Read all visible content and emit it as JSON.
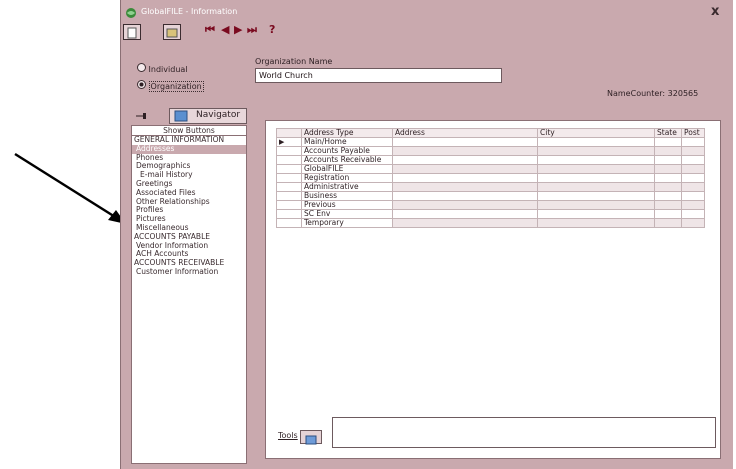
{
  "window": {
    "title": "GlobalFILE - Information",
    "close": "x"
  },
  "toolbar": {
    "help": "?",
    "nav_first": "⏮",
    "nav_prev": "◀",
    "nav_next": "▶",
    "nav_last": "⏭"
  },
  "type_selector": {
    "individual_label": "Individual",
    "organization_label": "Organization",
    "selected": "Organization"
  },
  "org": {
    "name_label": "Organization Name",
    "name_value": "World Church",
    "name_counter_label": "NameCounter:",
    "name_counter_value": "320565"
  },
  "navigator": {
    "pin_icon": "pin-icon",
    "button_label": "Navigator",
    "show_buttons": "Show Buttons",
    "items": [
      {
        "label": "GENERAL INFORMATION",
        "indent": 0,
        "selected": false
      },
      {
        "label": "Addresses",
        "indent": 1,
        "selected": true
      },
      {
        "label": "Phones",
        "indent": 1,
        "selected": false
      },
      {
        "label": "Demographics",
        "indent": 1,
        "selected": false
      },
      {
        "label": "E-mail History",
        "indent": 2,
        "selected": false
      },
      {
        "label": "Greetings",
        "indent": 1,
        "selected": false
      },
      {
        "label": "Associated Files",
        "indent": 1,
        "selected": false
      },
      {
        "label": "Other Relationships",
        "indent": 1,
        "selected": false
      },
      {
        "label": "Profiles",
        "indent": 1,
        "selected": false
      },
      {
        "label": "Pictures",
        "indent": 1,
        "selected": false
      },
      {
        "label": "Miscellaneous",
        "indent": 1,
        "selected": false
      },
      {
        "label": "ACCOUNTS PAYABLE",
        "indent": 0,
        "selected": false
      },
      {
        "label": "Vendor Information",
        "indent": 1,
        "selected": false
      },
      {
        "label": "ACH Accounts",
        "indent": 1,
        "selected": false
      },
      {
        "label": "ACCOUNTS RECEIVABLE",
        "indent": 0,
        "selected": false
      },
      {
        "label": "Customer Information",
        "indent": 1,
        "selected": false
      }
    ]
  },
  "grid": {
    "columns": [
      "Address Type",
      "Address",
      "City",
      "State",
      "Post"
    ],
    "rows": [
      {
        "type": "Main/Home",
        "current": true
      },
      {
        "type": "Accounts Payable",
        "current": false
      },
      {
        "type": "Accounts Receivable",
        "current": false
      },
      {
        "type": "GlobalFILE",
        "current": false
      },
      {
        "type": "Registration",
        "current": false
      },
      {
        "type": "Administrative",
        "current": false
      },
      {
        "type": "Business",
        "current": false
      },
      {
        "type": "Previous",
        "current": false
      },
      {
        "type": "SC Env",
        "current": false
      },
      {
        "type": "Temporary",
        "current": false
      }
    ]
  },
  "tools": {
    "label": "Tools"
  },
  "colors": {
    "window_bg": "#c9a9ae",
    "selected_bg": "#c9a9ae",
    "nav_arrow": "#7a0a1f"
  }
}
